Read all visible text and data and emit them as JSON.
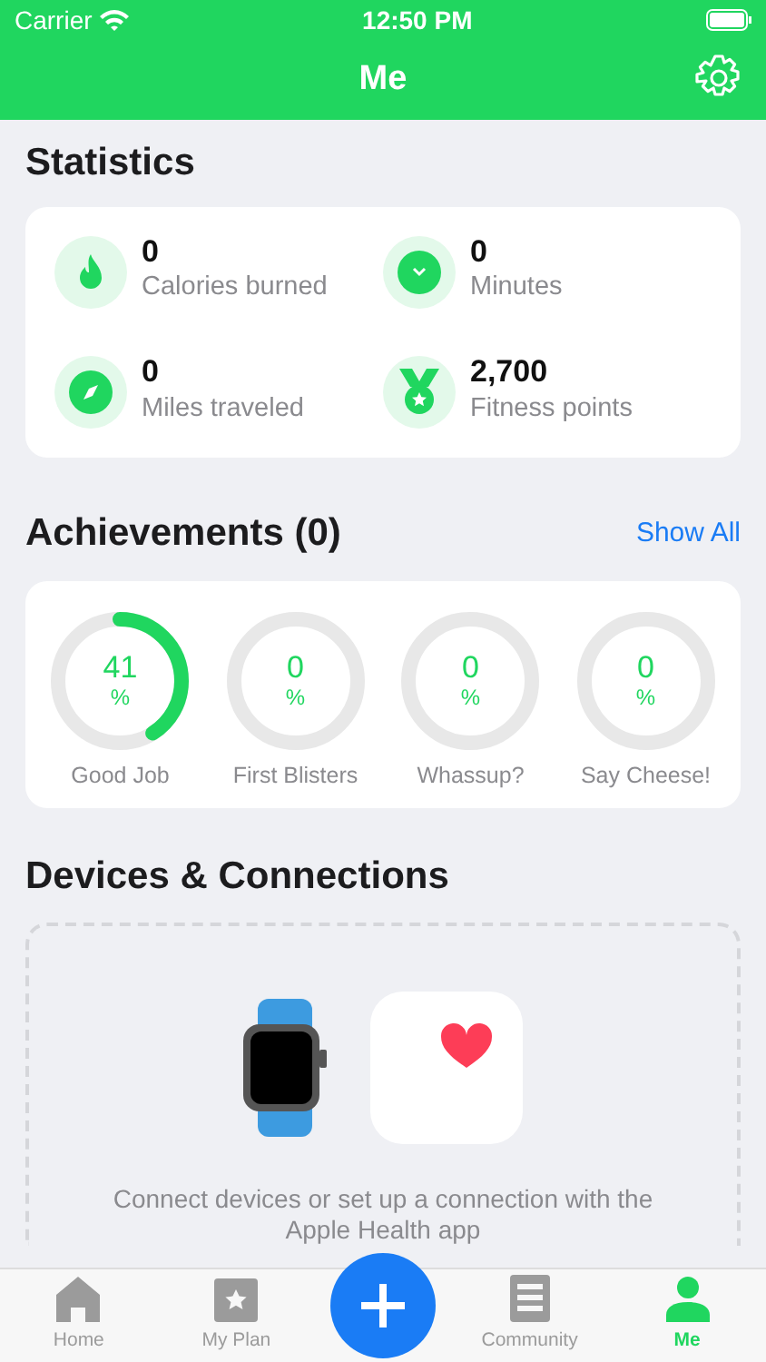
{
  "status_bar": {
    "carrier": "Carrier",
    "time": "12:50 PM"
  },
  "nav_bar": {
    "title": "Me"
  },
  "statistics": {
    "title": "Statistics",
    "items": [
      {
        "kind": "calories",
        "value": "0",
        "label": "Calories burned"
      },
      {
        "kind": "minutes",
        "value": "0",
        "label": "Minutes"
      },
      {
        "kind": "miles",
        "value": "0",
        "label": "Miles traveled"
      },
      {
        "kind": "points",
        "value": "2,700",
        "label": "Fitness points"
      }
    ]
  },
  "achievements": {
    "title": "Achievements (0)",
    "link": "Show All",
    "items": [
      {
        "value": "41",
        "unit": "%",
        "label": "Good Job"
      },
      {
        "value": "0",
        "unit": "%",
        "label": "First Blisters"
      },
      {
        "value": "0",
        "unit": "%",
        "label": "Whassup?"
      },
      {
        "value": "0",
        "unit": "%",
        "label": "Say Cheese!"
      }
    ]
  },
  "devices": {
    "title": "Devices & Connections",
    "description": "Connect devices or set up a connection with the Apple Health app"
  },
  "tab_bar": [
    {
      "kind": "home",
      "label": "Home",
      "selected": false
    },
    {
      "kind": "plan",
      "label": "My Plan",
      "selected": false
    },
    {
      "kind": "add"
    },
    {
      "kind": "community",
      "label": "Community",
      "selected": false
    },
    {
      "kind": "me",
      "label": "Me",
      "selected": true
    }
  ]
}
